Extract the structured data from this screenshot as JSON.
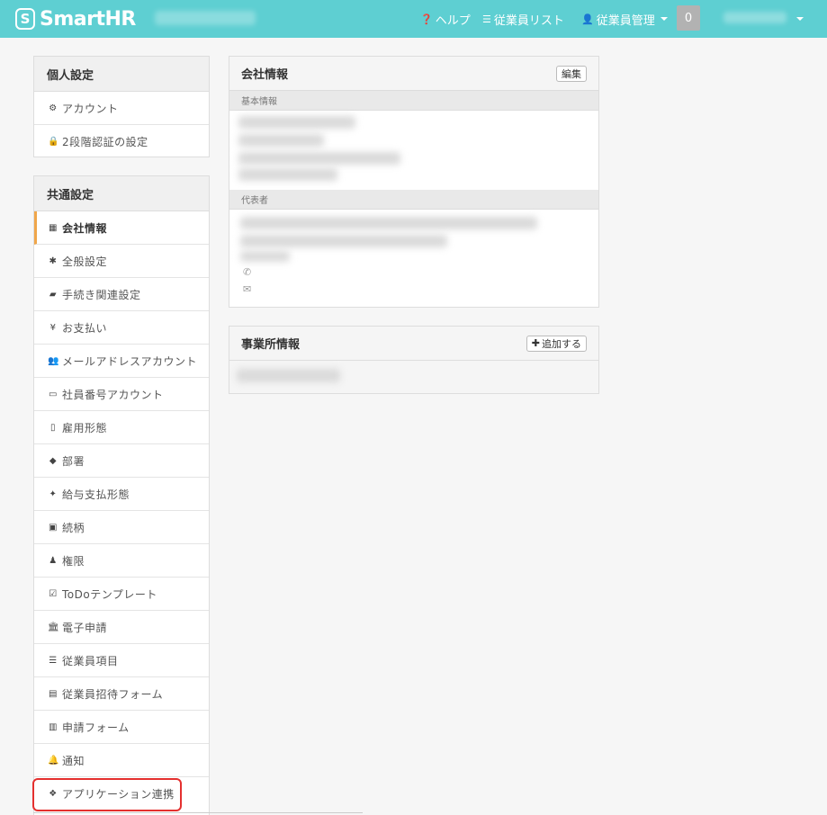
{
  "header": {
    "logo_badge": "S",
    "logo_text": "SmartHR",
    "nav": {
      "help": "ヘルプ",
      "employee_list": "従業員リスト",
      "employee_manage": "従業員管理"
    },
    "notification_count": "0",
    "icons": {
      "help": "question-circle-icon",
      "list": "list-icon",
      "user": "user-icon"
    }
  },
  "sidebar": {
    "personal": {
      "title": "個人設定",
      "items": [
        {
          "label": "アカウント",
          "icon": "gear-icon"
        },
        {
          "label": "2段階認証の設定",
          "icon": "lock-icon"
        }
      ]
    },
    "common": {
      "title": "共通設定",
      "items": [
        {
          "label": "会社情報",
          "icon": "building-icon"
        },
        {
          "label": "全般設定",
          "icon": "asterisk-icon"
        },
        {
          "label": "手続き関連設定",
          "icon": "book-icon"
        },
        {
          "label": "お支払い",
          "icon": "yen-icon"
        },
        {
          "label": "メールアドレスアカウント",
          "icon": "users-icon"
        },
        {
          "label": "社員番号アカウント",
          "icon": "id-card-icon"
        },
        {
          "label": "雇用形態",
          "icon": "id-badge-icon"
        },
        {
          "label": "部署",
          "icon": "tags-icon"
        },
        {
          "label": "給与支払形態",
          "icon": "pay-icon"
        },
        {
          "label": "続柄",
          "icon": "family-icon"
        },
        {
          "label": "権限",
          "icon": "user-key-icon"
        },
        {
          "label": "ToDoテンプレート",
          "icon": "checkbox-icon"
        },
        {
          "label": "電子申請",
          "icon": "bank-icon"
        },
        {
          "label": "従業員項目",
          "icon": "list-ul-icon"
        },
        {
          "label": "従業員招待フォーム",
          "icon": "file-icon"
        },
        {
          "label": "申請フォーム",
          "icon": "form-icon"
        },
        {
          "label": "通知",
          "icon": "bell-icon"
        },
        {
          "label": "アプリケーション連携",
          "icon": "cubes-icon"
        }
      ]
    }
  },
  "company_panel": {
    "title": "会社情報",
    "edit_button": "編集",
    "basic_info_label": "基本情報",
    "representative_label": "代表者"
  },
  "office_panel": {
    "title": "事業所情報",
    "add_button": "追加する"
  }
}
